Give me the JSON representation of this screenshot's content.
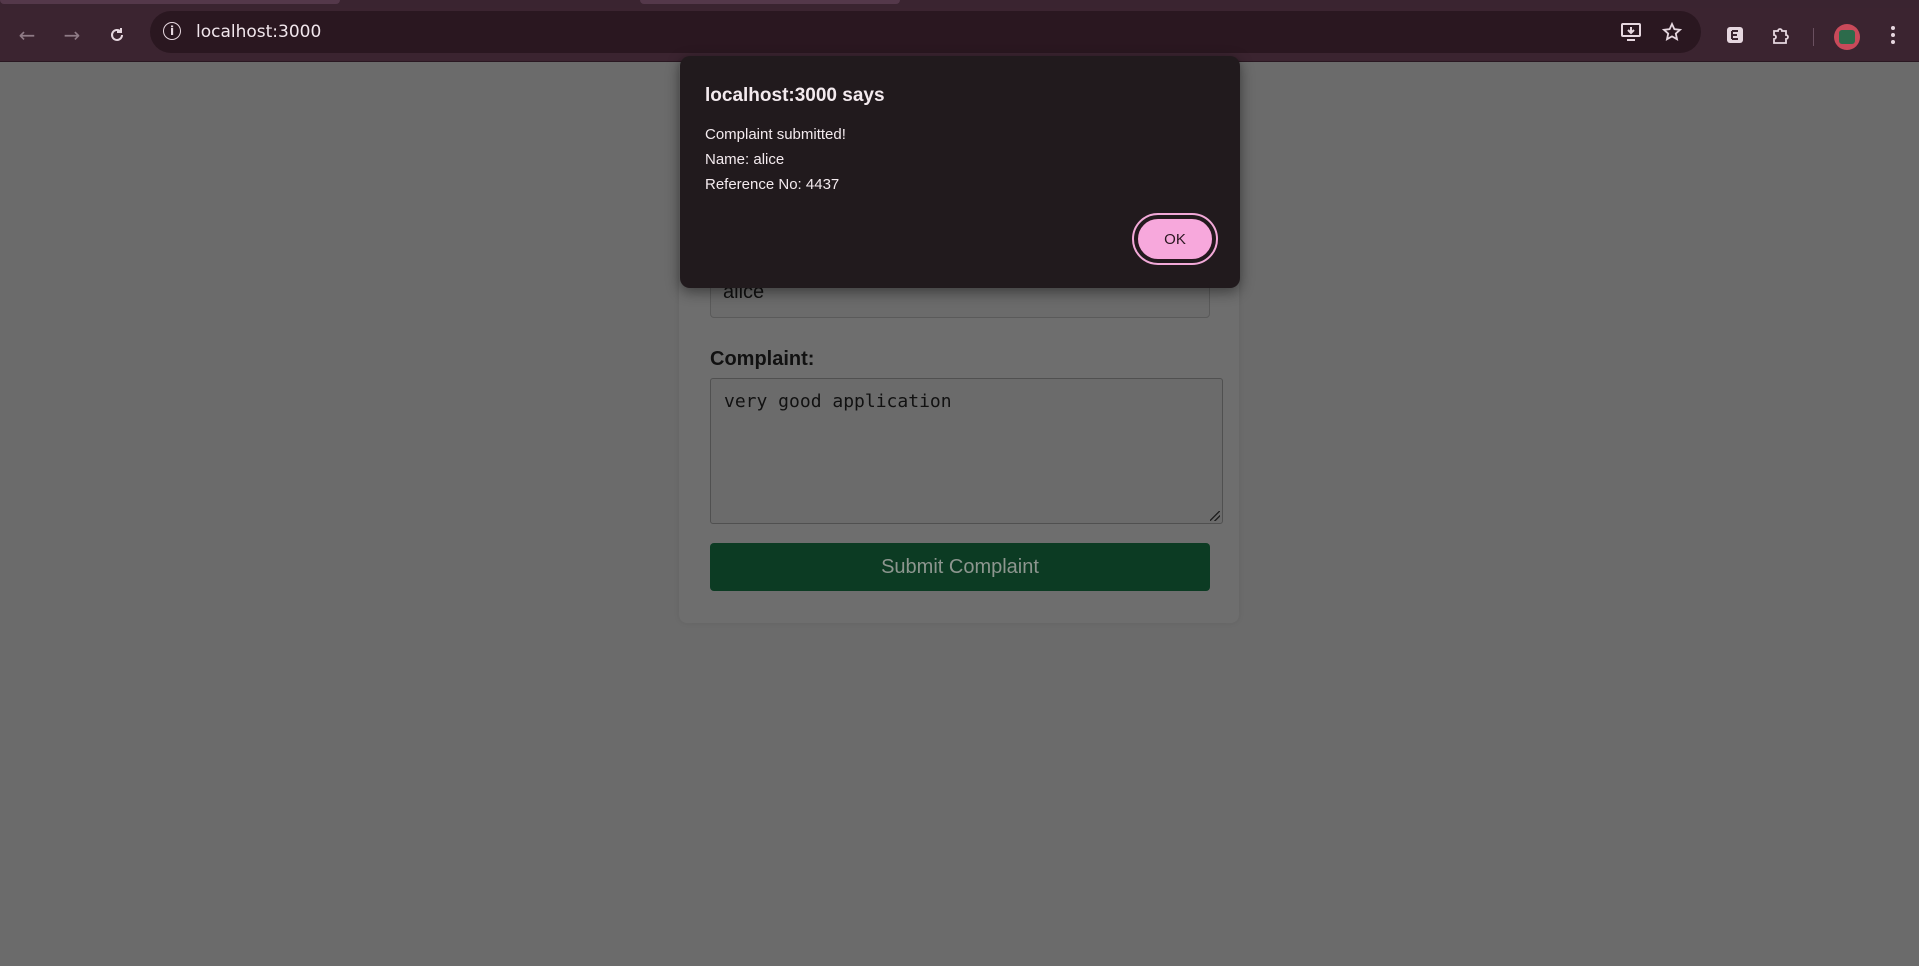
{
  "browser": {
    "url": "localhost:3000"
  },
  "form": {
    "name_value": "alice",
    "complaint_label": "Complaint:",
    "complaint_value": "very good application",
    "submit_label": "Submit Complaint"
  },
  "dialog": {
    "title": "localhost:3000 says",
    "lines": [
      "Complaint submitted!",
      "Name: alice",
      "Reference No: 4437"
    ],
    "ok_label": "OK"
  },
  "colors": {
    "accent": "#f7a8dc",
    "submit_bg": "#0c3b23",
    "chrome_bg": "#3b2430"
  }
}
